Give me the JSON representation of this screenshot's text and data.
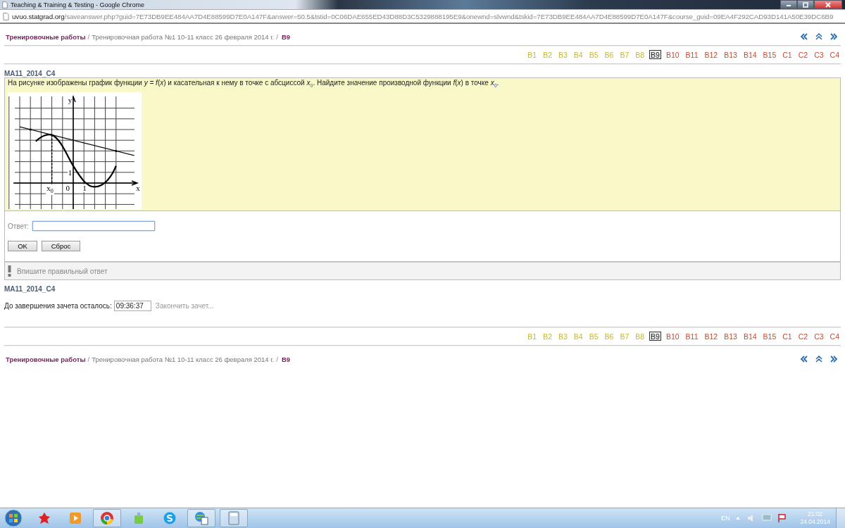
{
  "window": {
    "title": "Teaching & Training & Testing - Google Chrome"
  },
  "address_bar": {
    "domain": "uvuo.statgrad.org",
    "path": "/saveanswer.php?guid=7E73DB9EE484AA7D4E88599D7E0A147F&answer=50.5&tstid=0C06DAE655ED43D88D3C5329888195E9&onewnd=slvwnd&tskid=7E73DB9EE484AA7D4E88599D7E0A147F&course_guid=09EA4F292CAD93D141A50E39DC6B9"
  },
  "breadcrumb_top": [
    {
      "kind": "link",
      "text": "Тренировочные работы"
    },
    {
      "kind": "sep",
      "text": "/"
    },
    {
      "kind": "text",
      "text": "Тренировочная работа №1 10-11 класс 26 февраля 2014 г."
    },
    {
      "kind": "sep",
      "text": "/"
    },
    {
      "kind": "current",
      "text": "B9"
    }
  ],
  "pages_top": [
    {
      "label": "B1",
      "selected": false,
      "color": "#c8b82c"
    },
    {
      "label": "B2",
      "selected": false,
      "color": "#c8b82c"
    },
    {
      "label": "B3",
      "selected": false,
      "color": "#c8b82c"
    },
    {
      "label": "B4",
      "selected": false,
      "color": "#c8b82c"
    },
    {
      "label": "B5",
      "selected": false,
      "color": "#c8b82c"
    },
    {
      "label": "B6",
      "selected": false,
      "color": "#c8b82c"
    },
    {
      "label": "B7",
      "selected": false,
      "color": "#c8b82c"
    },
    {
      "label": "B8",
      "selected": false,
      "color": "#c8b82c"
    },
    {
      "label": "B9",
      "selected": true
    },
    {
      "label": "B10",
      "selected": false,
      "color": "#d2452a"
    },
    {
      "label": "B11",
      "selected": false,
      "color": "#d2452a"
    },
    {
      "label": "B12",
      "selected": false,
      "color": "#d2452a"
    },
    {
      "label": "B13",
      "selected": false,
      "color": "#d2452a"
    },
    {
      "label": "B14",
      "selected": false,
      "color": "#d2452a"
    },
    {
      "label": "B15",
      "selected": false,
      "color": "#d2452a"
    },
    {
      "label": "C1",
      "selected": false,
      "color": "#d2452a"
    },
    {
      "label": "C2",
      "selected": false,
      "color": "#d2452a"
    },
    {
      "label": "C3",
      "selected": false,
      "color": "#d2452a"
    },
    {
      "label": "C4",
      "selected": false,
      "color": "#d2452a"
    }
  ],
  "task": {
    "id": "MA11_2014_C4",
    "question": "На рисунке изображены график функции *y = f*(*x*) и касательная к нему в точке с абсциссой *x*$_{0}$. Найдите значение производной функции *f*(*x*) в точке *x*$_{0}$.",
    "figure_labels": [
      {
        "kind": "y",
        "text": "y"
      },
      {
        "kind": "yone",
        "text": "1"
      },
      {
        "kind": "x0",
        "text": "x$_{0}$"
      },
      {
        "kind": "origin",
        "text": "0"
      },
      {
        "kind": "xone",
        "text": "1"
      },
      {
        "kind": "x",
        "text": "x"
      }
    ]
  },
  "answer": {
    "label": "Ответ:"
  },
  "buttons": [
    "OK",
    "Сброс"
  ],
  "hint": "Впишите правильный ответ",
  "task_id_bottom": "MA11_2014_C4",
  "timer": {
    "label": "До завершения зачета осталось:",
    "value": "09:36:37",
    "finish_link": "Закончить зачет..."
  },
  "pages_bottom": [
    {
      "label": "B1",
      "selected": false,
      "color": "#c8b82c"
    },
    {
      "label": "B2",
      "selected": false,
      "color": "#c8b82c"
    },
    {
      "label": "B3",
      "selected": false,
      "color": "#c8b82c"
    },
    {
      "label": "B4",
      "selected": false,
      "color": "#c8b82c"
    },
    {
      "label": "B5",
      "selected": false,
      "color": "#c8b82c"
    },
    {
      "label": "B6",
      "selected": false,
      "color": "#c8b82c"
    },
    {
      "label": "B7",
      "selected": false,
      "color": "#c8b82c"
    },
    {
      "label": "B8",
      "selected": false,
      "color": "#c8b82c"
    },
    {
      "label": "B9",
      "selected": true
    },
    {
      "label": "B10",
      "selected": false,
      "color": "#d2452a"
    },
    {
      "label": "B11",
      "selected": false,
      "color": "#d2452a"
    },
    {
      "label": "B12",
      "selected": false,
      "color": "#d2452a"
    },
    {
      "label": "B13",
      "selected": false,
      "color": "#d2452a"
    },
    {
      "label": "B14",
      "selected": false,
      "color": "#d2452a"
    },
    {
      "label": "B15",
      "selected": false,
      "color": "#d2452a"
    },
    {
      "label": "C1",
      "selected": false,
      "color": "#d2452a"
    },
    {
      "label": "C2",
      "selected": false,
      "color": "#d2452a"
    },
    {
      "label": "C3",
      "selected": false,
      "color": "#d2452a"
    },
    {
      "label": "C4",
      "selected": false,
      "color": "#d2452a"
    }
  ],
  "breadcrumb_bottom": [
    {
      "kind": "link",
      "text": "Тренировочные работы"
    },
    {
      "kind": "sep",
      "text": "/"
    },
    {
      "kind": "text",
      "text": "Тренировочная работа №1 10-11 класс 26 февраля 2014 г."
    },
    {
      "kind": "sep",
      "text": "/"
    },
    {
      "kind": "current",
      "text": "B9"
    }
  ],
  "taskbar": {
    "language": "EN",
    "time": "21:02",
    "date": "24.04.2014"
  }
}
